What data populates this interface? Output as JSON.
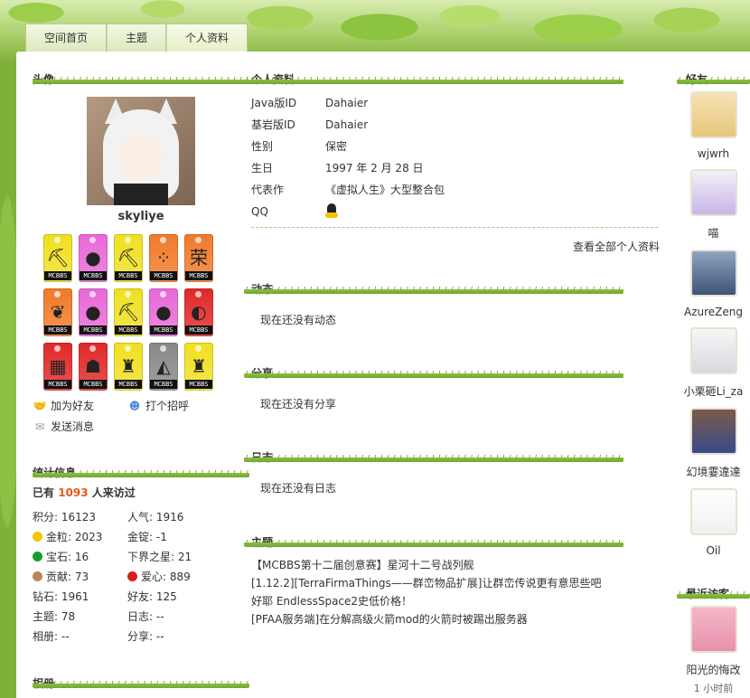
{
  "nav": {
    "tabs": [
      "空间首页",
      "主题",
      "个人资料"
    ],
    "active": 2
  },
  "left": {
    "avatar_title": "头像",
    "username": "skyliye",
    "medals": [
      {
        "color": "#f0e020",
        "glyph": "⛏",
        "tag": "MCBBS"
      },
      {
        "color": "#e868d8",
        "glyph": "●",
        "tag": "MCBBS"
      },
      {
        "color": "#f0e020",
        "glyph": "⛏",
        "tag": "MCBBS"
      },
      {
        "color": "#f07a2a",
        "glyph": "⁘",
        "tag": "MCBBS"
      },
      {
        "color": "#f07a2a",
        "glyph": "荣",
        "tag": "MCBBS"
      },
      {
        "color": "#f07a2a",
        "glyph": "❦",
        "tag": "MCBBS"
      },
      {
        "color": "#e868d8",
        "glyph": "●",
        "tag": "MCBBS"
      },
      {
        "color": "#f0e020",
        "glyph": "⛏",
        "tag": "MCBBS"
      },
      {
        "color": "#e868d8",
        "glyph": "●",
        "tag": "MCBBS"
      },
      {
        "color": "#e02828",
        "glyph": "◐",
        "tag": "MCBBS"
      },
      {
        "color": "#e02828",
        "glyph": "▦",
        "tag": "MCBBS"
      },
      {
        "color": "#e02828",
        "glyph": "☗",
        "tag": "MCBBS"
      },
      {
        "color": "#f0e020",
        "glyph": "♜",
        "tag": "MCBBS"
      },
      {
        "color": "#888888",
        "glyph": "◭",
        "tag": "MCBBS"
      },
      {
        "color": "#f0e020",
        "glyph": "♜",
        "tag": "MCBBS"
      }
    ],
    "actions": [
      {
        "label": "加为好友",
        "icon": "handshake-icon"
      },
      {
        "label": "打个招呼",
        "icon": "greet-icon"
      },
      {
        "label": "发送消息",
        "icon": "envelope-icon"
      }
    ],
    "stats_title": "统计信息",
    "visits_prefix": "已有",
    "visits_count": "1093",
    "visits_suffix": "人来访过",
    "stats": [
      {
        "label": "积分: 16123",
        "icon": ""
      },
      {
        "label": "人气: 1916",
        "icon": ""
      },
      {
        "label": "金粒: 2023",
        "icon": "gold-nugget-icon",
        "color": "#f5c400"
      },
      {
        "label": "金锭: -1",
        "icon": ""
      },
      {
        "label": "宝石: 16",
        "icon": "emerald-icon",
        "color": "#1e9b2a"
      },
      {
        "label": "下界之星: 21",
        "icon": ""
      },
      {
        "label": "贡献: 73",
        "icon": "cookie-icon",
        "color": "#b9855a"
      },
      {
        "label": "爱心: 889",
        "icon": "apple-icon",
        "color": "#d91c1c"
      },
      {
        "label": "钻石: 1961",
        "icon": ""
      },
      {
        "label": "好友: 125",
        "icon": ""
      },
      {
        "label": "主题: 78",
        "icon": ""
      },
      {
        "label": "日志: --",
        "icon": ""
      },
      {
        "label": "相册: --",
        "icon": ""
      },
      {
        "label": "分享: --",
        "icon": ""
      }
    ],
    "album_title": "相册"
  },
  "main": {
    "profile_title": "个人资料",
    "profile_rows": [
      {
        "label": "Java版ID",
        "value": "Dahaier"
      },
      {
        "label": "基岩版ID",
        "value": "Dahaier"
      },
      {
        "label": "性别",
        "value": "保密"
      },
      {
        "label": "生日",
        "value": "1997 年 2 月 28 日"
      },
      {
        "label": "代表作",
        "value": "《虚拟人生》大型整合包"
      },
      {
        "label": "QQ",
        "value": ""
      }
    ],
    "view_all": "查看全部个人资料",
    "feed_title": "动态",
    "feed_empty": "现在还没有动态",
    "share_title": "分享",
    "share_empty": "现在还没有分享",
    "blog_title": "日志",
    "blog_empty": "现在还没有日志",
    "threads_title": "主题",
    "threads": [
      "【MCBBS第十二届创意赛】星河十二号战列舰",
      "[1.12.2][TerraFirmaThings——群峦物品扩展]让群峦传说更有意思些吧",
      "好耶 EndlessSpace2史低价格！",
      "[PFAA服务端]在分解高级火箭mod的火箭时被踢出服务器"
    ]
  },
  "right": {
    "friends_title": "好友",
    "friends": [
      {
        "name": "wjwrh",
        "colors": [
          "#f6e2b4",
          "#e7c67a"
        ]
      },
      {
        "name": "喵",
        "colors": [
          "#f3f0f8",
          "#c8b6e6"
        ]
      },
      {
        "name": "AzureZeng",
        "colors": [
          "#8fa4c0",
          "#3e5478"
        ]
      },
      {
        "name": "小栗砸Li_za",
        "colors": [
          "#f7f7f7",
          "#d8d8e0"
        ]
      },
      {
        "name": "幻境霎違達",
        "colors": [
          "#7a5a4a",
          "#3b4a8a"
        ]
      },
      {
        "name": "Oil",
        "colors": [
          "#ffffff",
          "#f0f0f0"
        ]
      }
    ],
    "visitors_title": "最近访客",
    "visitor": {
      "name": "阳光的悔改",
      "time": "1 小时前"
    }
  }
}
